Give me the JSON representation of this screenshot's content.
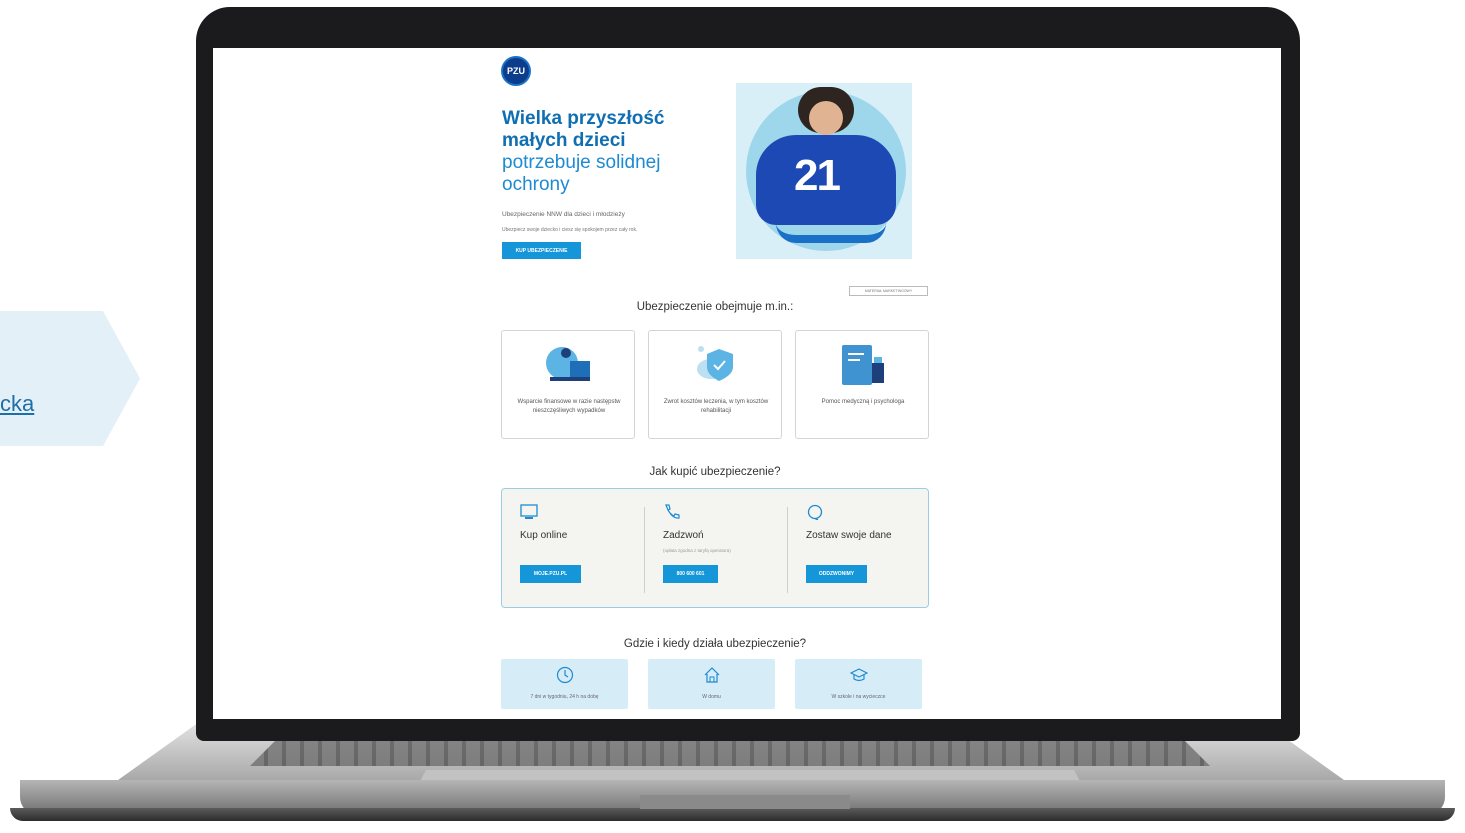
{
  "side_tab": {
    "link_text": "cka"
  },
  "page": {
    "logo_text": "PZU",
    "hero": {
      "title_bold_line1": "Wielka przyszłość",
      "title_bold_line2": "małych dzieci",
      "title_line3": "potrzebuje solidnej",
      "title_line4": "ochrony",
      "subtitle": "Ubezpieczenie NNW dla dzieci i młodzieży",
      "subtext": "Ubezpiecz swoje dziecko i ciesz się spokojem przez cały rok.",
      "cta": "KUP UBEZPIECZENIE",
      "jersey_number": "21"
    },
    "marketing_badge": "MATERIAŁ MARKETINGOWY",
    "coverage": {
      "heading": "Ubezpieczenie obejmuje m.in.:",
      "cards": [
        {
          "text": "Wsparcie finansowe w razie następstw nieszczęśliwych wypadków"
        },
        {
          "text": "Zwrot kosztów leczenia, w tym kosztów rehabilitacji"
        },
        {
          "text": "Pomoc medyczną i psychologa"
        }
      ]
    },
    "how_to_buy": {
      "heading": "Jak kupić ubezpieczenie?",
      "options": [
        {
          "title": "Kup online",
          "note": "",
          "button": "MOJE.PZU.PL",
          "icon": "monitor-icon"
        },
        {
          "title": "Zadzwoń",
          "note": "(opłata zgodna z taryfą operatora)",
          "button": "800 600 601",
          "icon": "phone-icon"
        },
        {
          "title": "Zostaw swoje dane",
          "note": "",
          "button": "ODDZWONIMY",
          "icon": "headset-icon"
        }
      ]
    },
    "where_when": {
      "heading": "Gdzie i kiedy działa ubezpieczenie?",
      "items": [
        {
          "text": "7 dni w tygodniu, 24 h na dobę",
          "icon": "clock-icon"
        },
        {
          "text": "W domu",
          "icon": "home-icon"
        },
        {
          "text": "W szkole i na wycieczce",
          "icon": "graduation-cap-icon"
        }
      ]
    }
  },
  "colors": {
    "accent": "#1496d8",
    "title_blue": "#1e8ad2",
    "brand_dark": "#0b3d8c"
  }
}
